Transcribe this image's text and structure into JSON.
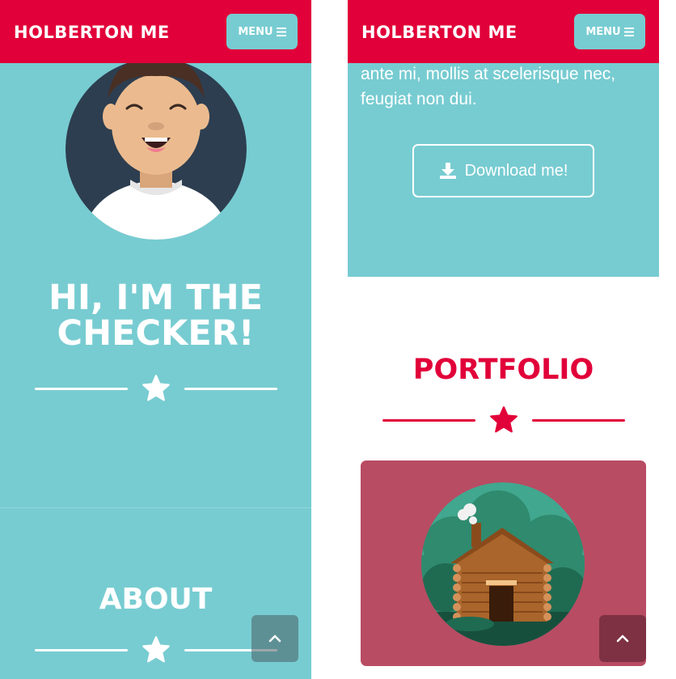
{
  "colors": {
    "brand_red": "#e10039",
    "teal": "#77ccd1",
    "card_pink": "#b84c63",
    "white": "#ffffff"
  },
  "navbar": {
    "brand": "HOLBERTON ME",
    "menu_label": "MENU",
    "menu_icon": "hamburger-icon"
  },
  "hero": {
    "title_line1": "HI, I'M THE",
    "title_line2": "CHECKER!",
    "divider_icon": "star-icon"
  },
  "about": {
    "title": "ABOUT",
    "text_line1": "ante mi, mollis at scelerisque nec,",
    "text_line2": "feugiat non dui.",
    "download_label": "Download me!",
    "download_icon": "download-icon"
  },
  "portfolio": {
    "title": "PORTFOLIO",
    "card_icon": "cabin-illustration"
  },
  "scroll_top": {
    "icon": "chevron-up-icon"
  }
}
